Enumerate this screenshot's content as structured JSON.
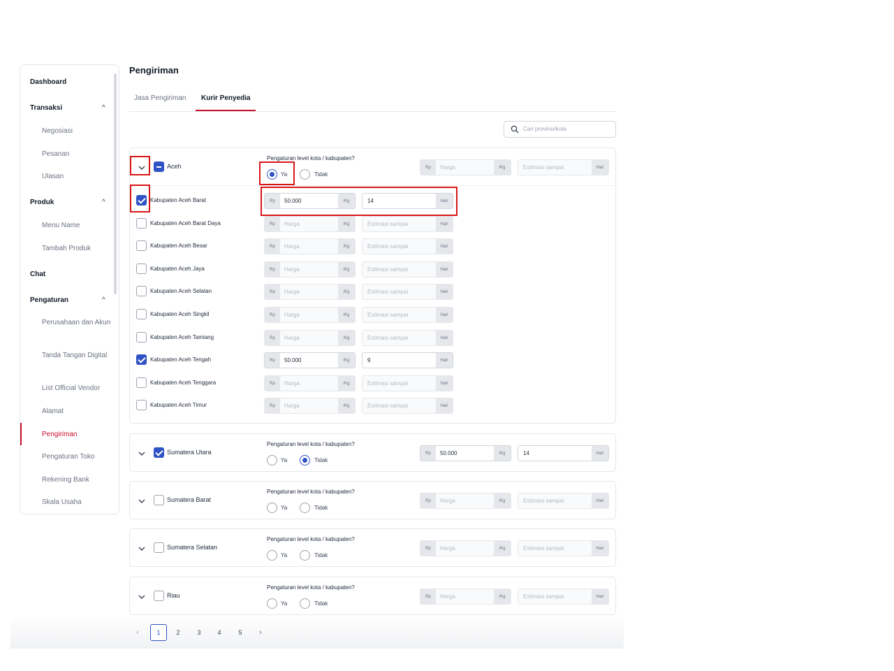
{
  "sidebar": {
    "items": [
      {
        "label": "Dashboard"
      },
      {
        "label": "Transaksi"
      },
      {
        "label": "Negosiasi"
      },
      {
        "label": "Pesanan"
      },
      {
        "label": "Ulasan"
      },
      {
        "label": "Produk"
      },
      {
        "label": "Menu Name"
      },
      {
        "label": "Tambah Produk"
      },
      {
        "label": "Chat"
      },
      {
        "label": "Pengaturan"
      },
      {
        "label": "Perusahaan dan Akun"
      },
      {
        "label": "Tanda Tangan Digital"
      },
      {
        "label": "List Official Vendor"
      },
      {
        "label": "Alamat"
      },
      {
        "label": "Pengiriman"
      },
      {
        "label": "Pengaturan Toko"
      },
      {
        "label": "Rekening Bank"
      },
      {
        "label": "Skala Usaha"
      }
    ],
    "active": "Pengiriman"
  },
  "page": {
    "title": "Pengiriman",
    "tabs": [
      {
        "label": "Jasa Pengiriman"
      },
      {
        "label": "Kurir Penyedia"
      }
    ],
    "active_tab": "Kurir Penyedia",
    "search_placeholder": "Cari provinsi/kota"
  },
  "common": {
    "question": "Pengaturan level kota / kabupaten?",
    "ya": "Ya",
    "tidak": "Tidak",
    "rp": "Rp",
    "per_kg": "/Kg",
    "hari": "Hari",
    "harga_placeholder": "Harga",
    "estimasi_placeholder": "Estimasi sampai"
  },
  "provinces": [
    {
      "name": "Aceh",
      "state": "indeterminate",
      "level_kota": "Ya",
      "harga": "",
      "estimasi": "",
      "cities": [
        {
          "name": "Kabupaten Aceh Barat",
          "checked": true,
          "harga": "50.000",
          "estimasi": "14"
        },
        {
          "name": "Kabupaten Aceh Barat Daya",
          "checked": false,
          "harga": "",
          "estimasi": ""
        },
        {
          "name": "Kabupaten Aceh Besar",
          "checked": false,
          "harga": "",
          "estimasi": ""
        },
        {
          "name": "Kabupaten Aceh Jaya",
          "checked": false,
          "harga": "",
          "estimasi": ""
        },
        {
          "name": "Kabupaten Aceh Selatan",
          "checked": false,
          "harga": "",
          "estimasi": ""
        },
        {
          "name": "Kabupaten Aceh Singkil",
          "checked": false,
          "harga": "",
          "estimasi": ""
        },
        {
          "name": "Kabupaten Aceh Tamiang",
          "checked": false,
          "harga": "",
          "estimasi": ""
        },
        {
          "name": "Kabupaten Aceh Tengah",
          "checked": true,
          "harga": "50.000",
          "estimasi": "9"
        },
        {
          "name": "Kabupaten Aceh Tenggara",
          "checked": false,
          "harga": "",
          "estimasi": ""
        },
        {
          "name": "Kabupaten Aceh Timur",
          "checked": false,
          "harga": "",
          "estimasi": ""
        }
      ]
    },
    {
      "name": "Sumatera Utara",
      "state": "checked",
      "level_kota": "Tidak",
      "harga": "50.000",
      "estimasi": "14"
    },
    {
      "name": "Sumatera Barat",
      "state": "unchecked",
      "level_kota": "",
      "harga": "",
      "estimasi": ""
    },
    {
      "name": "Sumatera Selatan",
      "state": "unchecked",
      "level_kota": "",
      "harga": "",
      "estimasi": ""
    },
    {
      "name": "Riau",
      "state": "unchecked",
      "level_kota": "",
      "harga": "",
      "estimasi": ""
    }
  ],
  "pagination": {
    "pages": [
      "1",
      "2",
      "3",
      "4",
      "5"
    ],
    "current": "1",
    "prev": "‹",
    "next": "›"
  },
  "colors": {
    "accent": "#c8102e",
    "primary": "#2f52c4",
    "highlight": "#d91616"
  }
}
